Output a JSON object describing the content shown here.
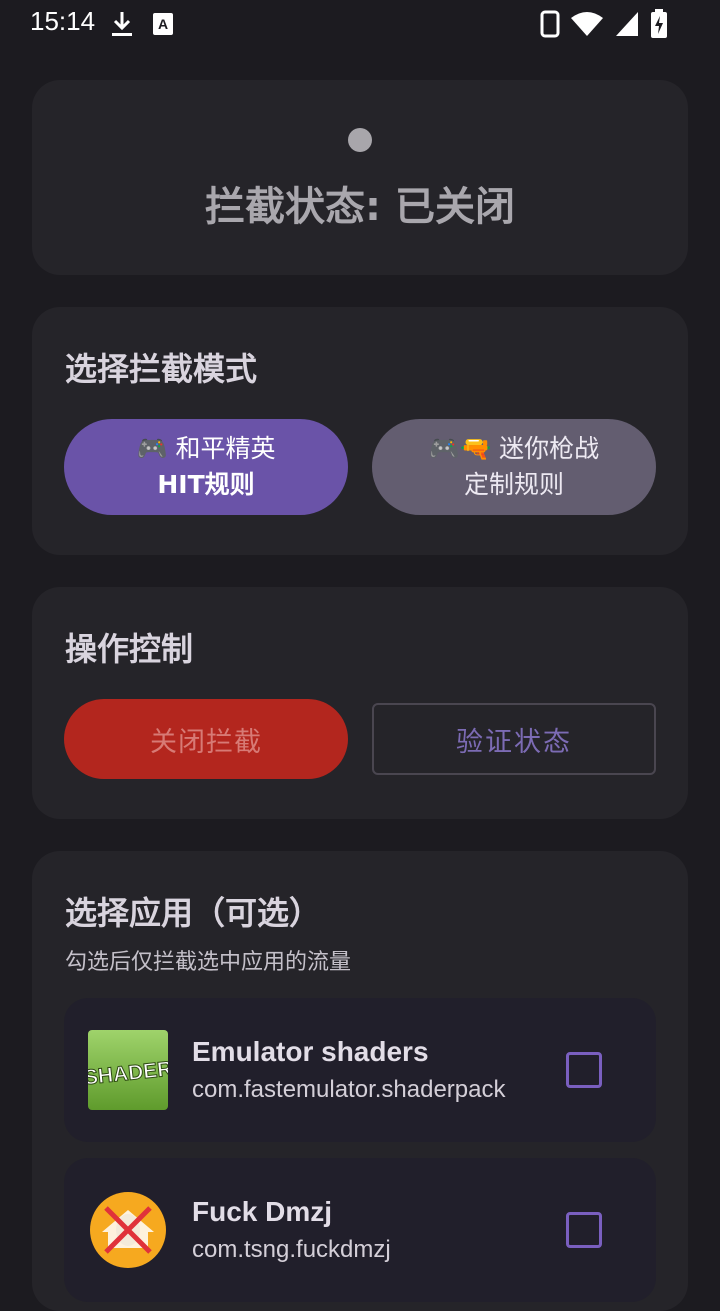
{
  "status_bar": {
    "time": "15:14",
    "icons": [
      "download-icon",
      "keyboard-a-icon",
      "phone-icon",
      "wifi-icon",
      "signal-icon",
      "battery-charging-icon"
    ]
  },
  "status_card": {
    "text": "拦截状态: 已关闭",
    "dot_color": "#a8a6ab"
  },
  "mode_card": {
    "title": "选择拦截模式",
    "options": [
      {
        "line1": "🎮 和平精英",
        "line2": "HIT规则",
        "selected": true
      },
      {
        "line1": "🎮🔫 迷你枪战",
        "line2": "定制规则",
        "selected": false
      }
    ]
  },
  "control_card": {
    "title": "操作控制",
    "close_label": "关闭拦截",
    "verify_label": "验证状态"
  },
  "apps_card": {
    "title": "选择应用（可选）",
    "subtitle": "勾选后仅拦截选中应用的流量",
    "apps": [
      {
        "name": "Emulator shaders",
        "package": "com.fastemulator.shaderpack",
        "icon": "shader-app-icon",
        "checked": false
      },
      {
        "name": "Fuck Dmzj",
        "package": "com.tsng.fuckdmzj",
        "icon": "dmzj-app-icon",
        "checked": false
      }
    ]
  },
  "colors": {
    "background": "#1c1b20",
    "card": "#252429",
    "accent_purple": "#6a53a8",
    "danger_red": "#b3261e"
  }
}
